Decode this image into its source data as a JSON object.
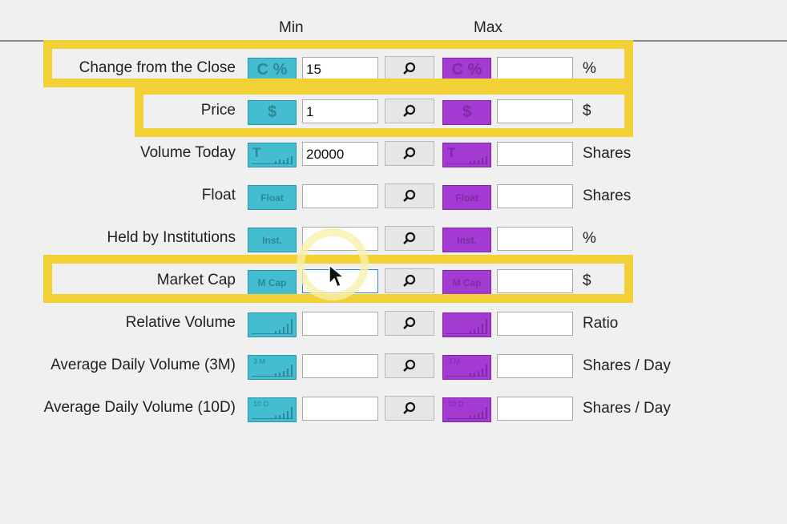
{
  "headers": {
    "min": "Min",
    "max": "Max"
  },
  "colors": {
    "min_button": "#45bdd0",
    "max_button": "#a33ad2",
    "highlight": "#f2d136"
  },
  "search_icon": "magnifier-icon",
  "rows": [
    {
      "label": "Change from the Close",
      "min_icon": "C %",
      "min_value": "15",
      "max_icon": "C %",
      "max_value": "",
      "unit": "%",
      "highlighted": true
    },
    {
      "label": "Price",
      "min_icon": "$",
      "min_value": "1",
      "max_icon": "$",
      "max_value": "",
      "unit": "$",
      "highlighted": true
    },
    {
      "label": "Volume Today",
      "min_icon": "T",
      "min_value": "20000",
      "max_icon": "T",
      "max_value": "",
      "unit": "Shares",
      "highlighted": false
    },
    {
      "label": "Float",
      "min_icon": "Float",
      "min_value": "",
      "max_icon": "Float",
      "max_value": "",
      "unit": "Shares",
      "highlighted": false
    },
    {
      "label": "Held by Institutions",
      "min_icon": "Inst.",
      "min_value": "",
      "max_icon": "Inst.",
      "max_value": "",
      "unit": "%",
      "highlighted": false
    },
    {
      "label": "Market Cap",
      "min_icon": "M Cap",
      "min_value": "",
      "max_icon": "M Cap",
      "max_value": "",
      "unit": "$",
      "highlighted": true
    },
    {
      "label": "Relative Volume",
      "min_icon": "",
      "min_value": "",
      "max_icon": "",
      "max_value": "",
      "unit": "Ratio",
      "highlighted": false
    },
    {
      "label": "Average Daily Volume (3M)",
      "min_icon": "3 M",
      "min_value": "",
      "max_icon": "3 M",
      "max_value": "",
      "unit": "Shares / Day",
      "highlighted": false
    },
    {
      "label": "Average Daily Volume (10D)",
      "min_icon": "10 D",
      "min_value": "",
      "max_icon": "10 D",
      "max_value": "",
      "unit": "Shares / Day",
      "highlighted": false
    }
  ]
}
